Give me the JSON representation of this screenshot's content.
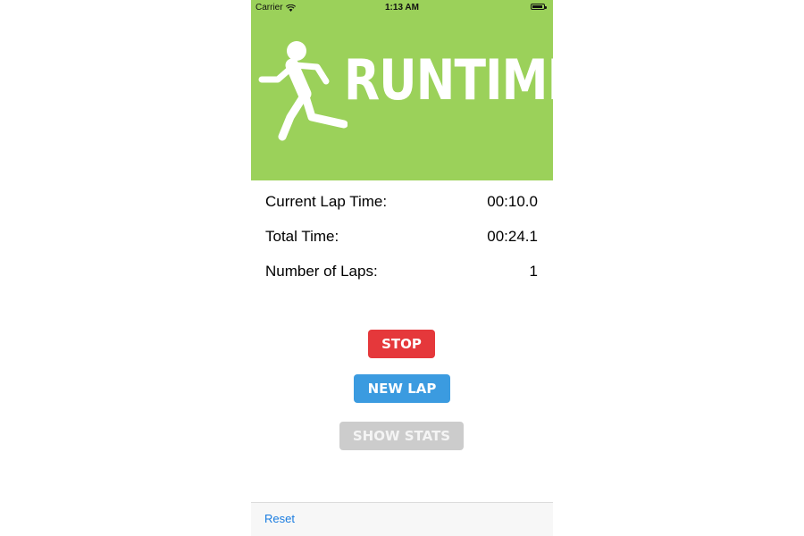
{
  "status_bar": {
    "carrier": "Carrier",
    "time": "1:13 AM",
    "wifi_icon": "wifi-icon",
    "battery_icon": "battery-icon"
  },
  "header": {
    "logo_text": "RUNTIME",
    "runner_icon": "running-man-icon",
    "background_color": "#9bd15a"
  },
  "stats": [
    {
      "label": "Current Lap Time:",
      "value": "00:10.0"
    },
    {
      "label": "Total Time:",
      "value": "00:24.1"
    },
    {
      "label": "Number of Laps:",
      "value": "1"
    }
  ],
  "buttons": {
    "stop": "STOP",
    "new_lap": "NEW LAP",
    "show_stats": "SHOW STATS"
  },
  "toolbar": {
    "reset": "Reset"
  },
  "colors": {
    "stop": "#e5383b",
    "new_lap": "#3b9be0",
    "show_stats_disabled": "#cccccc",
    "link": "#1a7ce0"
  }
}
